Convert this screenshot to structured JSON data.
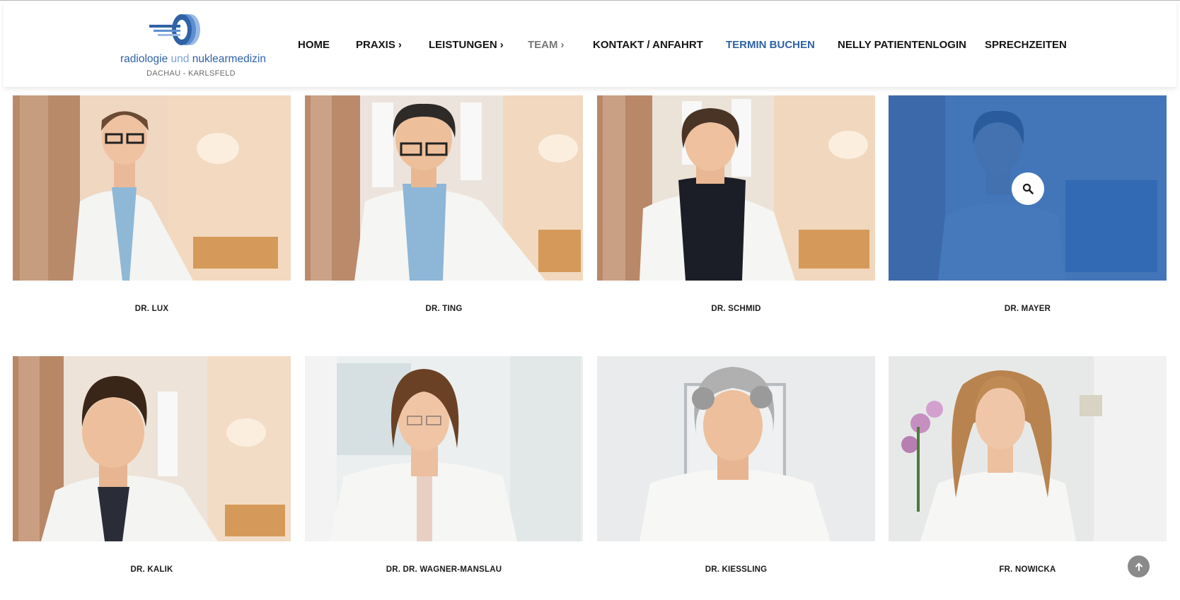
{
  "header": {
    "logo_text_a": "radiologie ",
    "logo_text_b": "und ",
    "logo_text_c": "nuklearmedizin",
    "logo_subtitle": "DACHAU - KARLSFELD",
    "logo_icon": "scanner-rings-logo"
  },
  "nav": {
    "items": [
      {
        "label": "HOME",
        "has_arrow": false,
        "state": "normal"
      },
      {
        "label": "PRAXIS",
        "has_arrow": true,
        "state": "normal"
      },
      {
        "label": "LEISTUNGEN",
        "has_arrow": true,
        "state": "normal"
      },
      {
        "label": "TEAM",
        "has_arrow": true,
        "state": "active"
      },
      {
        "label": "KONTAKT / ANFAHRT",
        "has_arrow": false,
        "state": "normal"
      },
      {
        "label": "TERMIN BUCHEN",
        "has_arrow": false,
        "state": "highlight"
      },
      {
        "label": "NELLY PATIENTENLOGIN",
        "has_arrow": false,
        "state": "normal"
      },
      {
        "label": "SPRECHZEITEN",
        "has_arrow": false,
        "state": "normal"
      }
    ],
    "arrow_glyph": "›"
  },
  "team": {
    "members": [
      {
        "name": "DR. LUX"
      },
      {
        "name": "DR. TING"
      },
      {
        "name": "DR. SCHMID"
      },
      {
        "name": "DR. MAYER",
        "hovered": true
      },
      {
        "name": "DR. KALIK"
      },
      {
        "name": "DR. DR. WAGNER-MANSLAU"
      },
      {
        "name": "DR. KIESSLING"
      },
      {
        "name": "FR. NOWICKA"
      }
    ]
  },
  "icons": {
    "zoom": "search-icon",
    "scroll_top": "arrow-up-icon"
  },
  "colors": {
    "brand_blue": "#2f62a6",
    "overlay_blue": "#2864b2",
    "active_nav": "#777777",
    "text": "#151515"
  }
}
